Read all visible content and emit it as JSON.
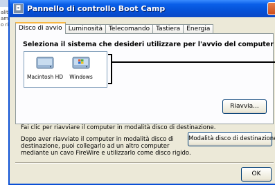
{
  "background_window": {
    "lines": [
      "alità",
      "amp",
      "o ri"
    ]
  },
  "window": {
    "title": "Pannello di controllo Boot Camp"
  },
  "tabs": [
    {
      "label": "Disco di avvio",
      "active": true
    },
    {
      "label": "Luminosità",
      "active": false
    },
    {
      "label": "Telecomando",
      "active": false
    },
    {
      "label": "Tastiera",
      "active": false
    },
    {
      "label": "Energia",
      "active": false
    }
  ],
  "startup_disk": {
    "heading": "Seleziona il sistema che desideri utilizzare per l'avvio del computer",
    "disks": [
      {
        "label": "Macintosh HD",
        "icon": "mac-drive-icon"
      },
      {
        "label": "Windows",
        "icon": "windows-drive-icon"
      }
    ],
    "restart_button": "Riavvia..."
  },
  "target_mode": {
    "instruction": "Fai clic per riavviare il computer in modalità disco di destinazione.",
    "description": "Dopo aver riavviato il computer in modalità disco di destinazione, puoi collegarlo ad un altro computer mediante un cavo FireWire e utilizzarlo come disco rigido.",
    "button": "Modalità disco di destinazione..."
  },
  "footer": {
    "ok_button": "OK"
  },
  "colors": {
    "titlebar": "#0552d8",
    "active_tab_accent": "#f7b641",
    "window_bg": "#ece9d8"
  }
}
